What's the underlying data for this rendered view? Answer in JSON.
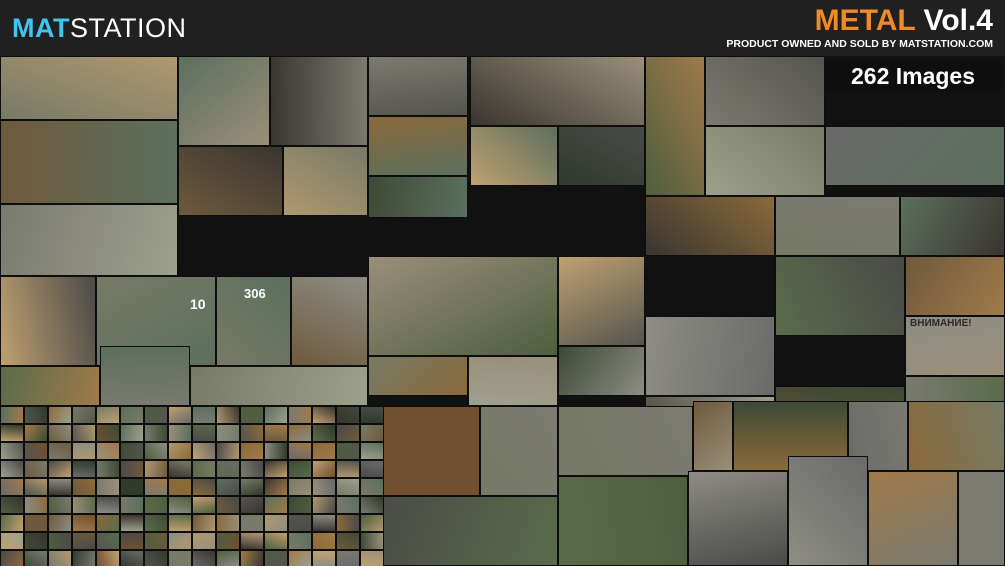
{
  "header": {
    "logo_accent": "MAT",
    "logo_rest": "STATION",
    "title_word": "METAL",
    "title_volume": "Vol.4",
    "subtitle": "PRODUCT OWNED AND SOLD BY MATSTATION.COM"
  },
  "badge": {
    "count_label": "262 Images"
  },
  "tile_labels": {
    "plate_1": "306",
    "plate_2": "10",
    "sign": "ВНИМАНИЕ!"
  },
  "colors": {
    "accent_blue": "#3fc6ee",
    "accent_orange": "#f08a24",
    "header_bg": "#202020"
  }
}
